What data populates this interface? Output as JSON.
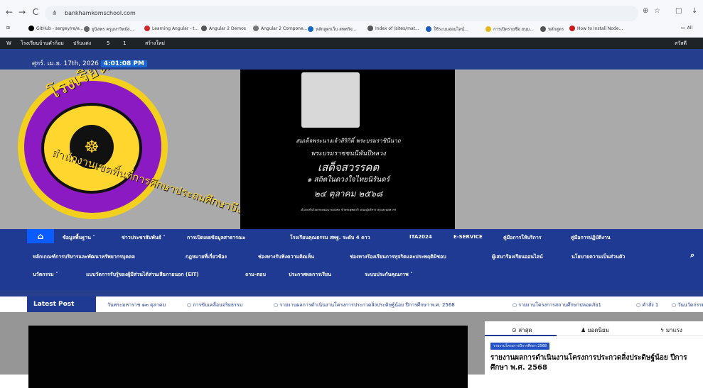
{
  "browser": {
    "url": "bankhamkomschool.com",
    "bookmarks": [
      "GitHub - sergey/re/e...",
      "ยูนิลพร ครูมหาวิทย์ล...",
      "Learning Angular - t...",
      "Angular 2 Demos",
      "Angular 2 Compone...",
      "หลักสูตรเว็บ สพทกิจ...",
      "Index of /sites/mat...",
      "ใช้ระบบออนไลน์...",
      "การเปิดรายชื่อ ยนม...",
      "หลักสูตร",
      "How to Install Node...",
      "All"
    ],
    "icons": {
      "back": "←",
      "forward": "→",
      "reload": "C",
      "site": "⋔",
      "zoom": "⊕",
      "star": "☆",
      "profile": "□",
      "download": "↓",
      "apps": "⊞",
      "bookmark_all": "▭"
    }
  },
  "admin_bar": {
    "site_name": "โรงเรียนบ้านคำก้อม",
    "customize": "ปรับแต่ง",
    "comments": "5",
    "updates": "1",
    "new": "สร้างใหม่",
    "greeting": "สวัสดี admin"
  },
  "site": {
    "date": "ศุกร์. เม.ย. 17th, 2026",
    "time": "4:01:08 PM",
    "logo_text": "โรงเรียนบ้านคำก้อม",
    "logo_bottom": "สำนักงานเขตพื้นที่การศึกษาประถมศึกษาบึงกาฬ",
    "memorial": {
      "line1": "สมเด็จพระนางเจ้าสิริกิติ์ พระบรมราชินีนาถ",
      "line2": "พระบรมราชชนนีพันปีหลวง",
      "line3": "เสด็จสวรรคต",
      "line4": "๑ สถิตในดวงใจไทยนิรันดร์",
      "line5": "๒๔ ตุลาคม ๒๕๖๘",
      "line6": "ด้วยเกล้าด้วยกระหม่อม ขอเดชะ ข้าพระพุทธเจ้า คณะผู้บริหาร ครูและบุคลากร"
    },
    "menu": {
      "row1": [
        "ข้อมูลพื้นฐาน ˅",
        "ข่าวประชาสัมพันธ์ ˅",
        "การเปิดเผยข้อมูลสาธารณะ",
        "โรงเรียนคุณธรรม สพฐ. ระดับ 4 ดาว",
        "ITA2024",
        "E-SERVICE",
        "คู่มือการให้บริการ",
        "คู่มือการปฏิบัติงาน"
      ],
      "row2": [
        "หลักเกณฑ์การบริหารและพัฒนาทรัพยากรบุคคล",
        "กฎหมายที่เกี่ยวข้อง",
        "ช่องทางรับฟังความคิดเห็น",
        "ช่องทางร้องเรียนการทุจริตและประพฤติมิชอบ",
        "ผู้เสนาร้องเรียนออนไลน์",
        "นโยบายความเป็นส่วนตัว"
      ],
      "row3": [
        "นวัตกรรม ˅",
        "แบบวัดการรับรู้ของผู้มีส่วนได้ส่วนเสียภายนอก (EIT)",
        "ถาม-ตอบ",
        "ประกาศผลการเรียน",
        "ระบบประกันคุณภาพ ˅"
      ]
    },
    "latest_label": "Latest Post",
    "latest_items": [
      "วันพระมหาราช ๑๓ ตุลาคม",
      "การขับเคลื่อนจริยธรรม",
      "รายงานผลการดำเนินงานโครงการประกวดสิ่งประดิษฐ์น้อย ปีการศึกษา พ.ศ. 2568",
      "รายงานโครงการสถานศึกษาปลอดภัย1",
      "คำสั่ง 1",
      "วันนวัตกรรม"
    ],
    "tabs": [
      {
        "label": "ล่าสุด",
        "icon": "clock-icon"
      },
      {
        "label": "ยอดนิยม",
        "icon": "thumb-icon"
      },
      {
        "label": "มาแรง",
        "icon": "bolt-icon"
      }
    ],
    "post_tag": "รายงานโครงการปีการศึกษา 2568",
    "post_title": "รายงานผลการดำเนินงานโครงการประกวดสิ่งประดิษฐ์น้อย ปีการศึกษา พ.ศ. 2568"
  }
}
